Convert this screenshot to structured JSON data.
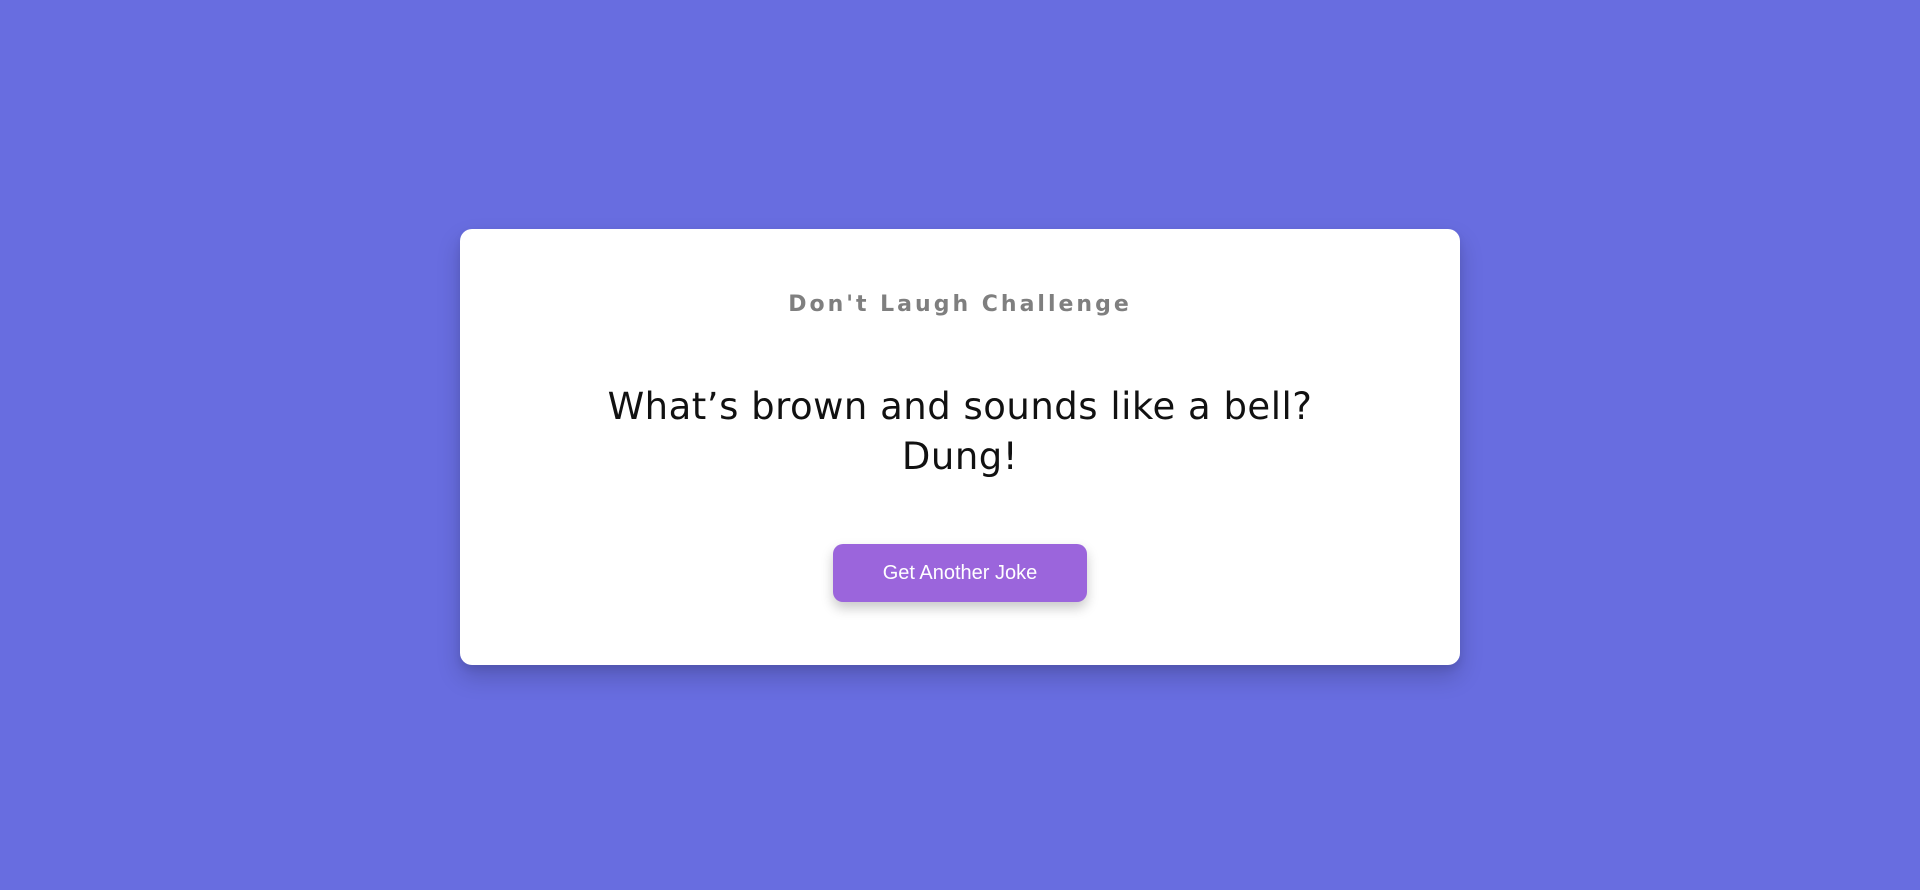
{
  "colors": {
    "background": "#686de0",
    "card": "#ffffff",
    "button": "#9b65dc",
    "title_text": "#7f7f7f",
    "joke_text": "#111111"
  },
  "card": {
    "title": "Don't Laugh Challenge",
    "joke": {
      "setup": "What’s brown and sounds like a bell?",
      "punchline": "Dung!"
    },
    "button_label": "Get Another Joke"
  }
}
